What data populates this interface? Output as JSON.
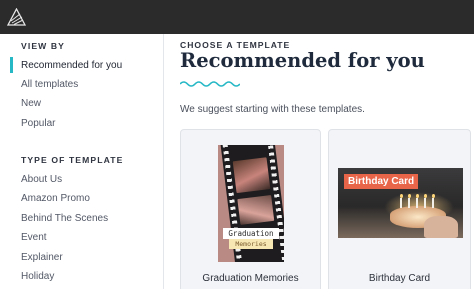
{
  "sidebar": {
    "view_by_title": "VIEW BY",
    "view_by_items": [
      {
        "label": "Recommended for you",
        "active": true
      },
      {
        "label": "All templates"
      },
      {
        "label": "New"
      },
      {
        "label": "Popular"
      }
    ],
    "type_title": "TYPE OF TEMPLATE",
    "type_items": [
      {
        "label": "About Us"
      },
      {
        "label": "Amazon Promo"
      },
      {
        "label": "Behind The Scenes"
      },
      {
        "label": "Event"
      },
      {
        "label": "Explainer"
      },
      {
        "label": "Holiday"
      }
    ]
  },
  "main": {
    "eyebrow": "CHOOSE A TEMPLATE",
    "heading": "Recommended for you",
    "subtitle": "We suggest starting with these templates.",
    "cards": [
      {
        "label": "Graduation Memories",
        "thumb_title": "Graduation",
        "thumb_subtitle": "Memories"
      },
      {
        "label": "Birthday Card",
        "thumb_title": "Birthday Card"
      }
    ]
  },
  "colors": {
    "topbar": "#2b2b2b",
    "accent": "#27b8c6",
    "heading": "#1f2b3d",
    "badge": "#e8654a"
  },
  "icons": {
    "logo": "app-logo-icon"
  }
}
